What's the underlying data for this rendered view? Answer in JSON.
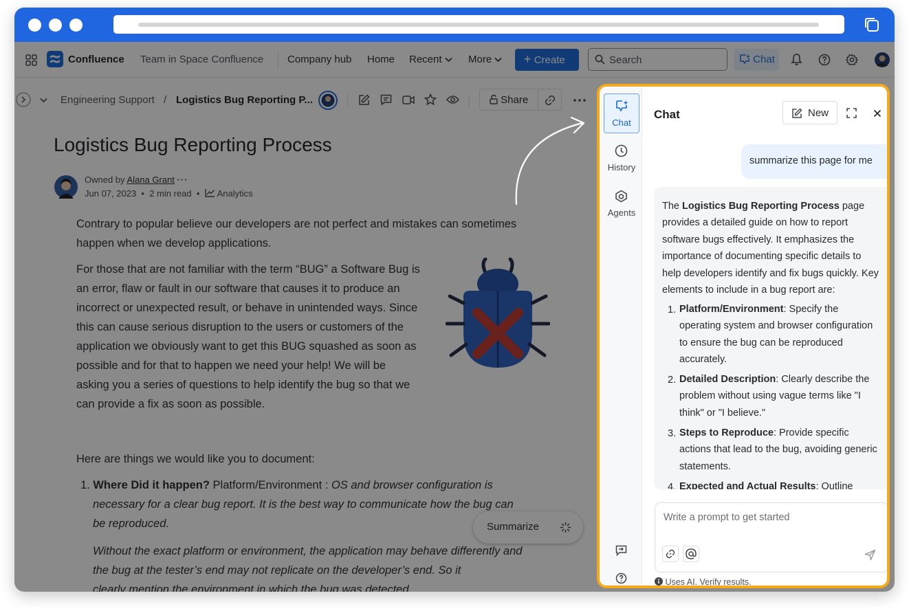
{
  "browser": {
    "url_placeholder": ""
  },
  "nav": {
    "app_name": "Confluence",
    "space_name": "Team in Space Confluence",
    "company_hub": "Company hub",
    "home": "Home",
    "recent": "Recent",
    "more": "More",
    "create": "Create",
    "search_placeholder": "Search",
    "chat": "Chat"
  },
  "page": {
    "breadcrumb_parent": "Engineering Support",
    "breadcrumb_sep": "/",
    "breadcrumb_current": "Logistics Bug Reporting P...",
    "share": "Share",
    "title": "Logistics Bug Reporting Process",
    "owned_by_label": "Owned by",
    "owner": "Alana Grant",
    "date": "Jun 07, 2023",
    "read_time": "2 min read",
    "analytics": "Analytics",
    "para1_line1": "Contrary to popular believe our developers are not perfect and mistakes can sometimes",
    "para1_line2": "happen when we develop applications.",
    "para2_lines": [
      "For those that are not familiar with the term “BUG” a Software Bug is",
      "an error, flaw or fault in our software that causes it to produce an",
      "incorrect or unexpected result, or behave in unintended ways. Since",
      "this can cause serious disruption to the users or customers of the",
      "application we obviously want to get this BUG squashed as soon as",
      "possible and for that to happen we need your help! We will be",
      "asking you a series of questions to help identify the bug so that we",
      "can provide a fix as soon as possible."
    ],
    "para3": "Here are things we would like you to document:",
    "item1_bold": "Where Did it happen?",
    "item1_rest": " Platform/Environment : ",
    "item1_italic_l1": "OS and browser configuration is",
    "item1_italic_l2": "necessary for a clear bug report. It is the best way to communicate how the bug can",
    "item1_italic_l3": "be reproduced.",
    "item1_sub_l1": "Without the exact platform or environment, the application may behave differently and",
    "item1_sub_l2": "the bug at the tester’s end may not replicate on the developer’s end. So it",
    "item1_sub_l3": "clearly mention the environment in which the bug was detected.",
    "summarize": "Summarize"
  },
  "chat_panel": {
    "rail": {
      "chat": "Chat",
      "history": "History",
      "agents": "Agents"
    },
    "title": "Chat",
    "new": "New",
    "user_message": "summarize this page for me",
    "ai_intro_1": "The ",
    "ai_intro_bold": "Logistics Bug Reporting Process",
    "ai_intro_2": " page provides a detailed guide on how to report software bugs effectively. It emphasizes the importance of documenting specific details to help developers identify and fix bugs quickly. Key elements to include in a bug report are:",
    "points": [
      {
        "num": "1.",
        "bold": "Platform/Environment",
        "text": ": Specify the operating system and browser configuration to ensure the bug can be reproduced accurately."
      },
      {
        "num": "2.",
        "bold": "Detailed Description",
        "text": ": Clearly describe the problem without using vague terms like \"I think\" or \"I believe.\""
      },
      {
        "num": "3.",
        "bold": "Steps to Reproduce",
        "text": ": Provide specific actions that lead to the bug, avoiding generic statements."
      },
      {
        "num": "4.",
        "bold": "Expected and Actual Results",
        "text": ": Outline"
      }
    ],
    "prompt_placeholder": "Write a prompt to get started",
    "disclaimer": "Uses AI. Verify results."
  },
  "colors": {
    "brand_blue": "#1868db",
    "titlebar": "#1f66e0",
    "highlight_border": "#f5aa1c"
  }
}
